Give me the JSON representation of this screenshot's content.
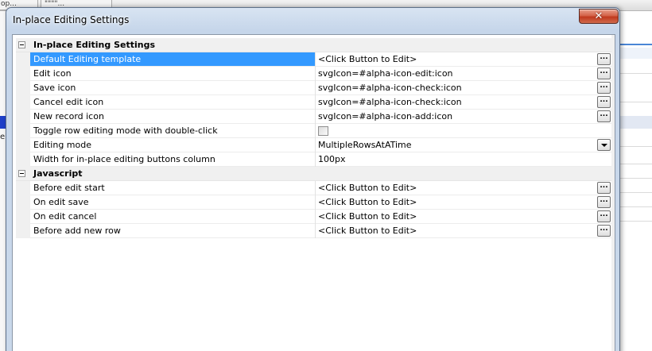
{
  "background": {
    "tabs": [
      "op...",
      "\"\"\"\"..."
    ],
    "left_word": "em"
  },
  "dialog": {
    "title": "In-place Editing Settings",
    "close_glyph": "✕"
  },
  "grid": {
    "categories": [
      {
        "title": "In-place Editing Settings",
        "rows": [
          {
            "name": "Default Editing template",
            "value": "<Click Button to Edit>",
            "editor": "ellipsis",
            "selected": true
          },
          {
            "name": "Edit icon",
            "value": "svgIcon=#alpha-icon-edit:icon",
            "editor": "ellipsis"
          },
          {
            "name": "Save icon",
            "value": "svgIcon=#alpha-icon-check:icon",
            "editor": "ellipsis"
          },
          {
            "name": "Cancel edit icon",
            "value": "svgIcon=#alpha-icon-check:icon",
            "editor": "ellipsis"
          },
          {
            "name": "New record icon",
            "value": "svgIcon=#alpha-icon-add:icon",
            "editor": "ellipsis"
          },
          {
            "name": "Toggle row editing mode with double-click",
            "value": "",
            "editor": "checkbox"
          },
          {
            "name": "Editing mode",
            "value": "MultipleRowsAtATime",
            "editor": "dropdown"
          },
          {
            "name": "Width for in-place editing buttons column",
            "value": "100px",
            "editor": "none"
          }
        ]
      },
      {
        "title": "Javascript",
        "rows": [
          {
            "name": "Before edit start",
            "value": "<Click Button to Edit>",
            "editor": "ellipsis"
          },
          {
            "name": "On edit save",
            "value": "<Click Button to Edit>",
            "editor": "ellipsis"
          },
          {
            "name": "On edit cancel",
            "value": "<Click Button to Edit>",
            "editor": "ellipsis"
          },
          {
            "name": "Before add new row",
            "value": "<Click Button to Edit>",
            "editor": "ellipsis"
          }
        ]
      }
    ],
    "ellipsis_label": "..."
  }
}
